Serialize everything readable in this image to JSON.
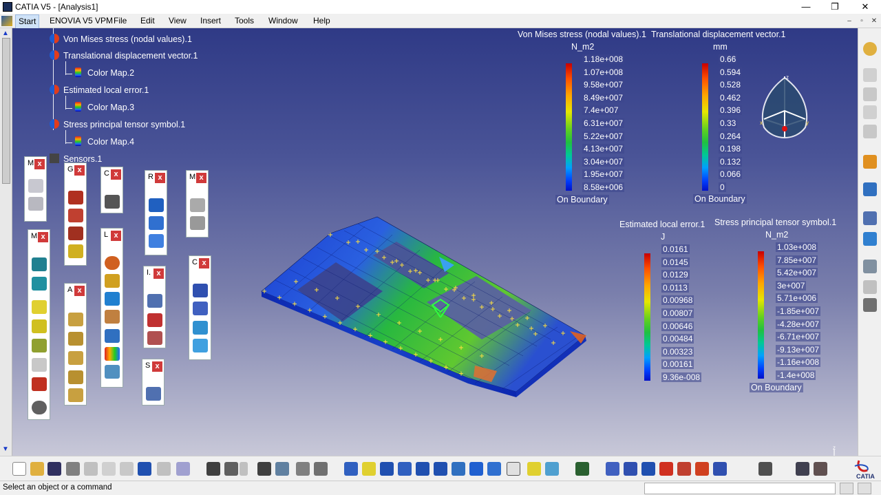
{
  "window": {
    "title": "CATIA V5 - [Analysis1]",
    "controls": {
      "minimize": "—",
      "restore": "❐",
      "close": "✕"
    }
  },
  "menubar": {
    "items": [
      "Start",
      "ENOVIA V5 VPM",
      "File",
      "Edit",
      "View",
      "Insert",
      "Tools",
      "Window",
      "Help"
    ],
    "mdi_controls": {
      "minimize": "–",
      "restore": "▫",
      "close": "✕"
    }
  },
  "tree": {
    "items": [
      {
        "label": "Von Mises stress (nodal values).1",
        "icon": "result-icon"
      },
      {
        "label": "Translational displacement vector.1",
        "icon": "result-icon"
      },
      {
        "label": "Color Map.2",
        "icon": "color-map-icon"
      },
      {
        "label": "Estimated local error.1",
        "icon": "result-icon"
      },
      {
        "label": "Color Map.3",
        "icon": "color-map-icon"
      },
      {
        "label": "Stress principal tensor symbol.1",
        "icon": "result-icon"
      },
      {
        "label": "Color Map.4",
        "icon": "color-map-icon"
      },
      {
        "label": "Sensors.1",
        "icon": "sensor-icon"
      }
    ]
  },
  "floating_toolbars": [
    {
      "caption": "M",
      "close": "x"
    },
    {
      "caption": "G",
      "close": "x"
    },
    {
      "caption": "C",
      "close": "x"
    },
    {
      "caption": "R",
      "close": "x"
    },
    {
      "caption": "M",
      "close": "x"
    },
    {
      "caption": "M",
      "close": "x"
    },
    {
      "caption": "L",
      "close": "x"
    },
    {
      "caption": "A",
      "close": "x"
    },
    {
      "caption": "I.",
      "close": "x"
    },
    {
      "caption": "C",
      "close": "x"
    },
    {
      "caption": "S",
      "close": "x"
    }
  ],
  "legends": {
    "von_mises": {
      "title": "Von Mises stress (nodal values).1",
      "unit": "N_m2",
      "values": [
        "1.18e+008",
        "1.07e+008",
        "9.58e+007",
        "8.49e+007",
        "7.4e+007",
        "6.31e+007",
        "5.22e+007",
        "4.13e+007",
        "3.04e+007",
        "1.95e+007",
        "8.58e+006"
      ],
      "footer": "On Boundary"
    },
    "displacement": {
      "title": "Translational displacement vector.1",
      "unit": "mm",
      "values": [
        "0.66",
        "0.594",
        "0.528",
        "0.462",
        "0.396",
        "0.33",
        "0.264",
        "0.198",
        "0.132",
        "0.066",
        "0"
      ],
      "footer": "On Boundary"
    },
    "local_error": {
      "title": "Estimated local error.1",
      "unit": "J",
      "values": [
        "0.0161",
        "0.0145",
        "0.0129",
        "0.0113",
        "0.00968",
        "0.00807",
        "0.00646",
        "0.00484",
        "0.00323",
        "0.00161",
        "9.36e-008"
      ]
    },
    "principal": {
      "title": "Stress principal tensor symbol.1",
      "unit": "N_m2",
      "values": [
        "1.03e+008",
        "7.85e+007",
        "5.42e+007",
        "3e+007",
        "5.71e+006",
        "-1.85e+007",
        "-4.28e+007",
        "-6.71e+007",
        "-9.13e+007",
        "-1.16e+008",
        "-1.4e+008"
      ],
      "footer": "On Boundary"
    }
  },
  "compass": {
    "z": "z",
    "x": "x",
    "y": "y"
  },
  "axis": {
    "z": "z",
    "x": "x",
    "y": "y"
  },
  "status": {
    "message": "Select an object or a command"
  },
  "brand": {
    "text": "CATIA"
  },
  "colors": {
    "viewport_top": "#2f3a86",
    "viewport_bottom": "#c8c8d8",
    "colormap": [
      "#c80000",
      "#ff4a00",
      "#ffa500",
      "#e6e600",
      "#9be000",
      "#28c828",
      "#00c896",
      "#00a0ff",
      "#0050ff",
      "#0010c8"
    ]
  }
}
